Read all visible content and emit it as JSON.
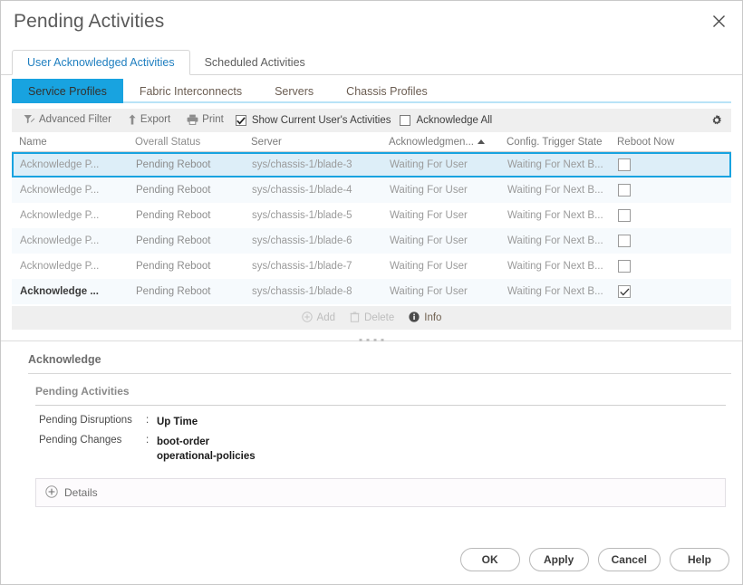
{
  "window": {
    "title": "Pending Activities",
    "close_icon": "close-icon"
  },
  "outer_tabs": [
    {
      "label": "User Acknowledged Activities",
      "active": true
    },
    {
      "label": "Scheduled Activities",
      "active": false
    }
  ],
  "inner_tabs": [
    {
      "label": "Service Profiles",
      "active": true
    },
    {
      "label": "Fabric Interconnects",
      "active": false
    },
    {
      "label": "Servers",
      "active": false
    },
    {
      "label": "Chassis Profiles",
      "active": false
    }
  ],
  "toolbar": {
    "advanced_filter": "Advanced Filter",
    "export": "Export",
    "print": "Print",
    "show_current_user": "Show Current User's Activities",
    "show_current_user_checked": true,
    "acknowledge_all": "Acknowledge All",
    "acknowledge_all_checked": false,
    "settings_icon": "gear-icon"
  },
  "table": {
    "columns": [
      "Name",
      "Overall Status",
      "Server",
      "Acknowledgmen...",
      "Config. Trigger State",
      "Reboot Now"
    ],
    "sort_column": "Acknowledgmen...",
    "sort_direction": "ascending",
    "rows": [
      {
        "name": "Acknowledge P...",
        "status": "Pending Reboot",
        "server": "sys/chassis-1/blade-3",
        "ack": "Waiting For User",
        "cfg": "Waiting For Next B...",
        "reboot": false,
        "selected": true
      },
      {
        "name": "Acknowledge P...",
        "status": "Pending Reboot",
        "server": "sys/chassis-1/blade-4",
        "ack": "Waiting For User",
        "cfg": "Waiting For Next B...",
        "reboot": false,
        "selected": false
      },
      {
        "name": "Acknowledge P...",
        "status": "Pending Reboot",
        "server": "sys/chassis-1/blade-5",
        "ack": "Waiting For User",
        "cfg": "Waiting For Next B...",
        "reboot": false,
        "selected": false
      },
      {
        "name": "Acknowledge P...",
        "status": "Pending Reboot",
        "server": "sys/chassis-1/blade-6",
        "ack": "Waiting For User",
        "cfg": "Waiting For Next B...",
        "reboot": false,
        "selected": false
      },
      {
        "name": "Acknowledge P...",
        "status": "Pending Reboot",
        "server": "sys/chassis-1/blade-7",
        "ack": "Waiting For User",
        "cfg": "Waiting For Next B...",
        "reboot": false,
        "selected": false
      },
      {
        "name": "Acknowledge ...",
        "status": "Pending Reboot",
        "server": "sys/chassis-1/blade-8",
        "ack": "Waiting For User",
        "cfg": "Waiting For Next B...",
        "reboot": true,
        "selected": false
      }
    ]
  },
  "crud_bar": {
    "add": "Add",
    "add_enabled": false,
    "delete": "Delete",
    "delete_enabled": false,
    "info": "Info",
    "info_enabled": true
  },
  "details": {
    "section_title": "Acknowledge",
    "card_title": "Pending Activities",
    "fields": [
      {
        "key": "Pending Disruptions",
        "sep": ":",
        "values": [
          "Up Time"
        ]
      },
      {
        "key": "Pending Changes",
        "sep": ":",
        "values": [
          "boot-order",
          "operational-policies"
        ]
      }
    ],
    "expander_label": "Details",
    "expander_icon": "plus-circle-icon"
  },
  "footer": {
    "buttons": [
      "OK",
      "Apply",
      "Cancel",
      "Help"
    ]
  },
  "colors": {
    "accent": "#18a3e0",
    "tab_underline": "#b9e3f7",
    "selected_row": "#ddeef8",
    "stripe": "#f6fafd",
    "toolbar_bg": "#efefef"
  }
}
